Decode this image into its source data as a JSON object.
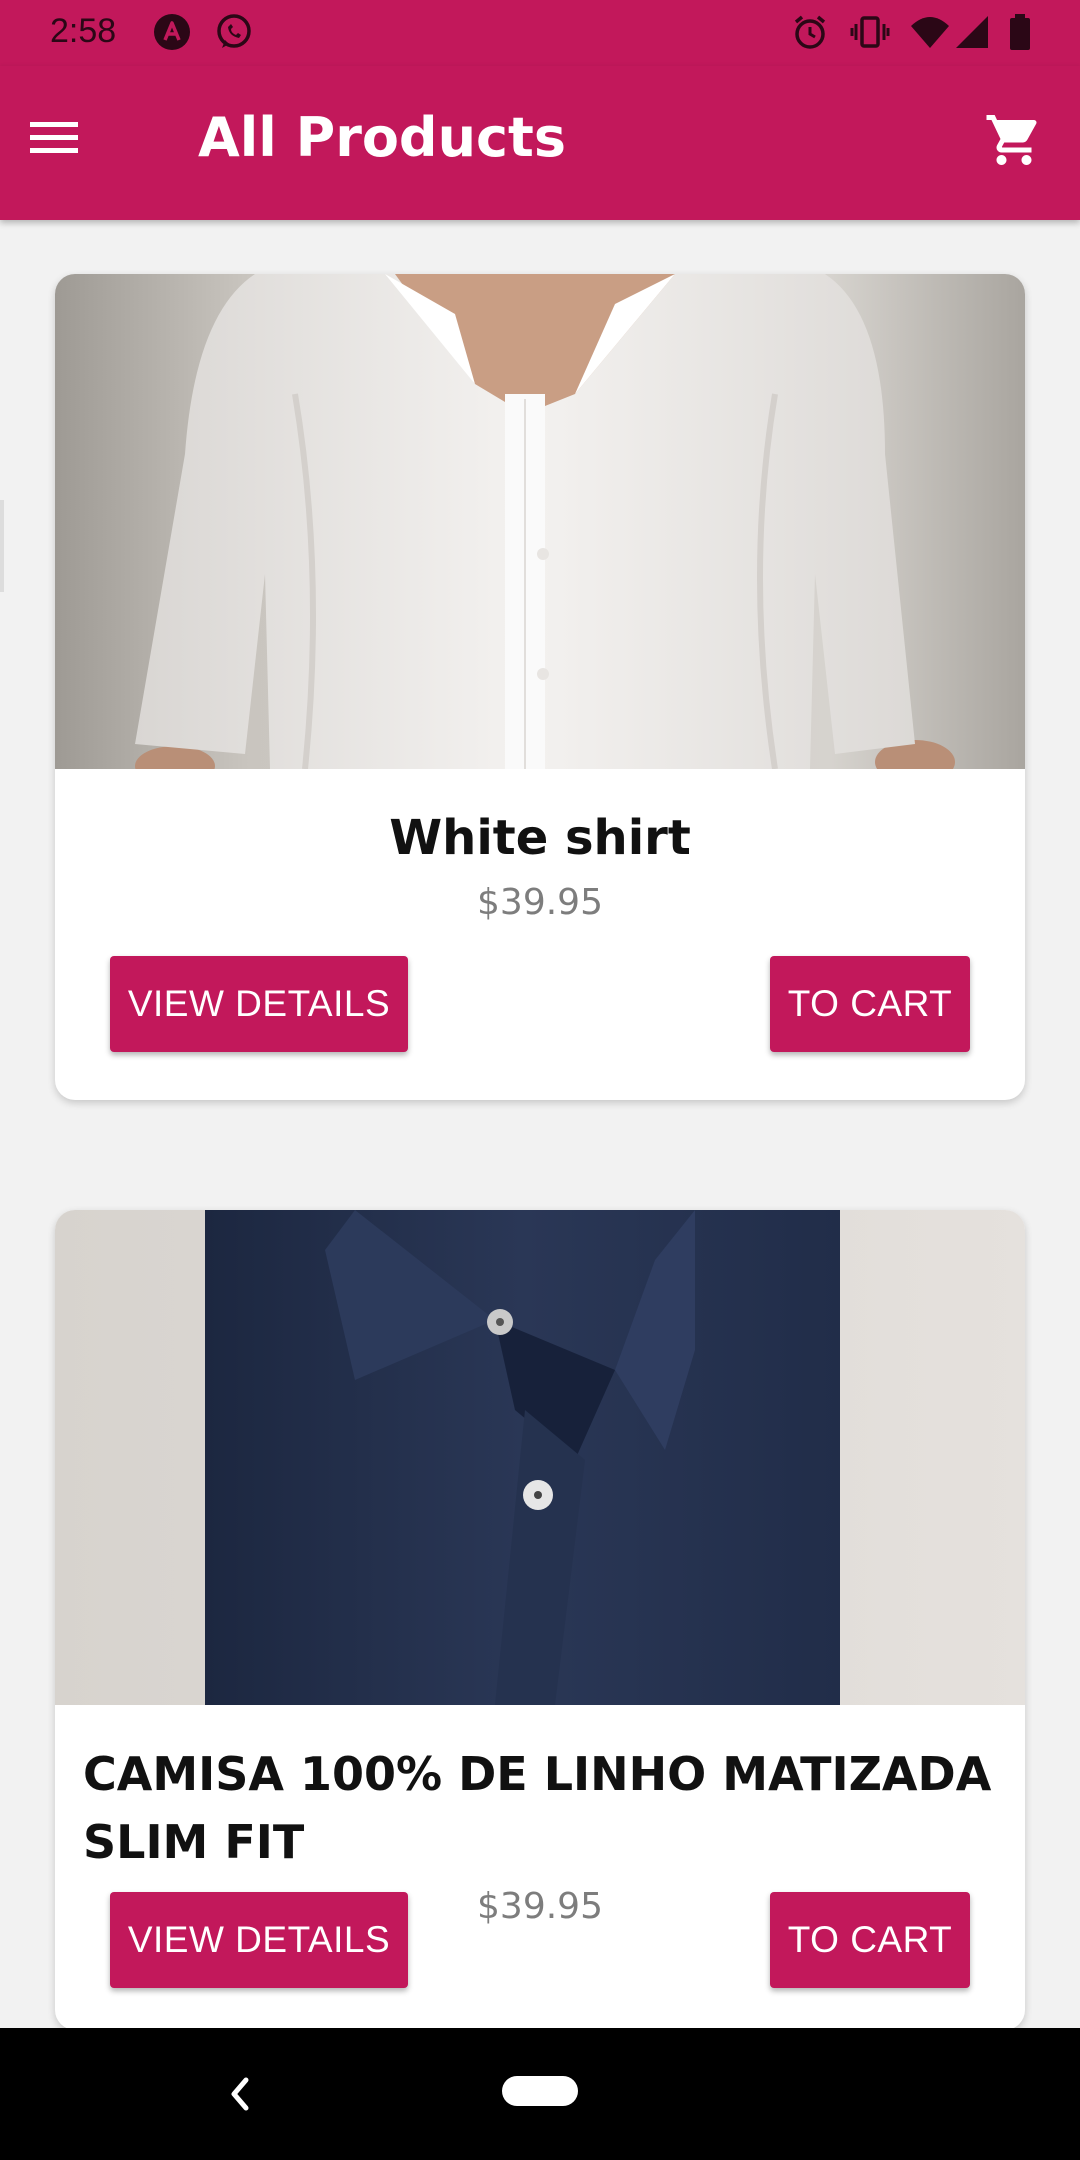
{
  "status_bar": {
    "time": "2:58",
    "icons": [
      "app-a-icon",
      "whatsapp-icon",
      "alarm-icon",
      "vibrate-icon",
      "wifi-icon",
      "signal-icon",
      "battery-icon"
    ]
  },
  "app_bar": {
    "title": "All Products",
    "menu_icon": "menu-icon",
    "cart_icon": "cart-icon"
  },
  "colors": {
    "primary": "#c2185b",
    "background": "#f2f2f2",
    "card": "#ffffff",
    "price": "#7d7d7d"
  },
  "products": [
    {
      "title": "White shirt",
      "price": "$39.95",
      "image": "white-shirt-photo",
      "view_label": "VIEW DETAILS",
      "cart_label": "TO CART"
    },
    {
      "title": "CAMISA 100% DE LINHO MATIZADA SLIM FIT",
      "price": "$39.95",
      "image": "navy-linen-shirt-photo",
      "view_label": "VIEW DETAILS",
      "cart_label": "TO CART"
    }
  ],
  "nav_bar": {
    "back_icon": "back-icon",
    "home_icon": "home-pill-icon"
  }
}
